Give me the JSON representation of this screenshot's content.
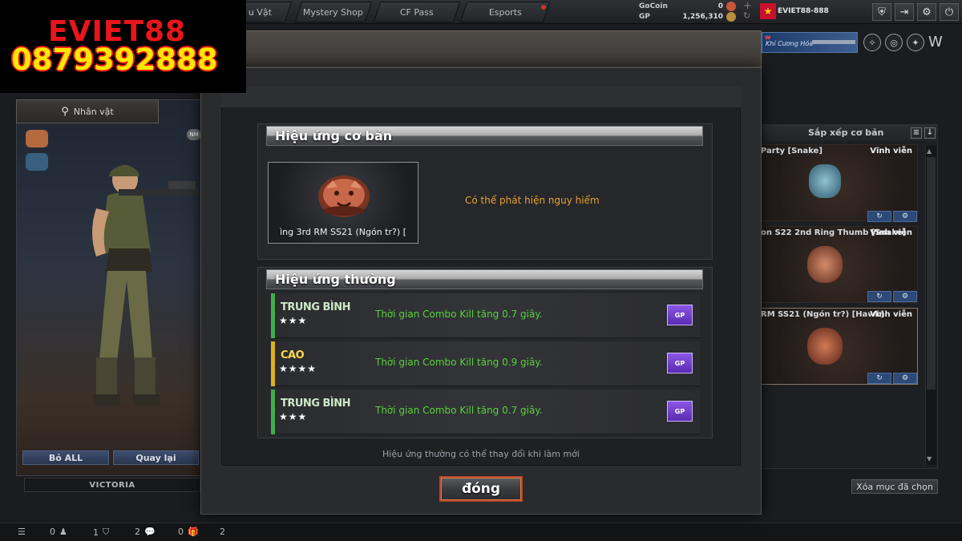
{
  "watermark": {
    "name": "EVIET88",
    "phone": "0879392888"
  },
  "topbar": {
    "tabs": [
      "u Vật",
      "Mystery Shop",
      "CF Pass",
      "Esports"
    ],
    "gocoin_label": "GoCoin",
    "gocoin_value": "0",
    "gp_label": "GP",
    "gp_value": "1,256,310",
    "username": "EVIET88-888"
  },
  "banner": {
    "tag": "w",
    "text": "Khí Cương Hóa"
  },
  "left": {
    "character_tab": "Nhân vật",
    "remove_all": "Bỏ ALL",
    "back": "Quay lại",
    "character_name": "VICTORIA"
  },
  "right": {
    "sort_label": "Sắp xếp cơ bản",
    "items": [
      {
        "name": "Party [Snake]",
        "duration": "Vĩnh viễn"
      },
      {
        "name": "on S22 2nd Ring Thumb [Snake]",
        "duration": "Vĩnh viễn"
      },
      {
        "name": "RM SS21 (Ngón tr?) [Hawk]",
        "duration": "Vĩnh viễn"
      }
    ],
    "clear_selected": "Xóa mục đã chọn"
  },
  "bottombar": {
    "counts": [
      "0",
      "1",
      "2",
      "0",
      "2"
    ]
  },
  "modal": {
    "basic_title": "Hiệu ứng cơ bản",
    "item_name": "ìng 3rd RM SS21 (Ngón tr?) [",
    "basic_effect": "Có thể phát hiện nguy hiểm",
    "normal_title": "Hiệu ứng thường",
    "effects": [
      {
        "grade": "TRUNG BÌNH",
        "stars": "★★★",
        "text": "Thời gian Combo Kill tăng 0.7 giây.",
        "color": "#3fae4a",
        "button": "GP"
      },
      {
        "grade": "CAO",
        "stars": "★★★★",
        "text": "Thời gian Combo Kill tăng 0.9 giây.",
        "color": "#e0b021",
        "button": "GP"
      },
      {
        "grade": "TRUNG BÌNH",
        "stars": "★★★",
        "text": "Thời gian Combo Kill tăng 0.7 giây.",
        "color": "#3fae4a",
        "button": "GP"
      }
    ],
    "footnote": "Hiệu ứng thường có thể thay đổi khi làm mới",
    "close_label": "đóng"
  },
  "colors": {
    "basic_effect": "#e7a12f",
    "effect_text": "#58d13a",
    "close_border": "#b44a2e"
  }
}
